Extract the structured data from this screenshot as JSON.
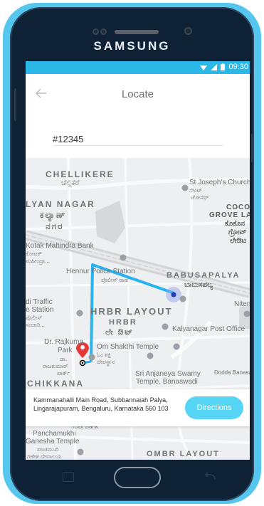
{
  "device": {
    "brand": "SAMSUNG"
  },
  "status_bar": {
    "time": "09:30",
    "icons": [
      "wifi-icon",
      "signal-icon",
      "battery-icon"
    ]
  },
  "app_bar": {
    "title": "Locate",
    "back_icon": "arrow-left-icon"
  },
  "search": {
    "value": "#12345"
  },
  "map": {
    "labels": {
      "chellikere": "CHELLIKERE",
      "chellikere_kn": "ಚೆಲ್ಲಿಕೆರೆ",
      "church": "St Joseph's Church",
      "church_kn1": "ಸೇಂಟ್",
      "church_kn2": "ಜೋಸೆಫ್",
      "kalyan_nagar": "LYAN NAGAR",
      "kalyan_kn1": "ಕಲ್ಯಾಣ್",
      "kalyan_kn2": "ನಗರ",
      "cocon": "COCON",
      "grove": "GROVE LA",
      "grove_kn1": "ಕೊಕೊನ",
      "grove_kn2": "ಗ್ರೋವ್",
      "grove_kn3": "ಲೇಔಟ",
      "kotak": "Kotak Mahindra Bank",
      "kotak_kn1": "ಕೋಟಕ್",
      "kotak_kn2": "ಮಹೀಂದ್ರಾ...",
      "hennur": "Hennur Police Station",
      "hennur_kn": "ಪೊಲೀಸ್ ಠಾಣೆ",
      "babusapalya": "BABUSAPALYA",
      "babusapalya_kn": "ಬಾಬುಸಪಲ್ಯ",
      "traffic1": "di Traffic",
      "traffic2": "e Station",
      "traffic_kn1": "ಪೊಲೀಸ್",
      "traffic_kn2": "ಸಂಚಾರಿ...",
      "hrbr": "HRBR LAYOUT",
      "hrbr2": "HRBR",
      "hrbr_kn": "ಲೇ ಔಟ್",
      "niten": "Niten",
      "kalyan_po": "Kalyanagar Post Office",
      "rajkumar": "Dr. Rajkuma",
      "park": "Park",
      "park_kn1": "ಡಾ.",
      "park_kn2": "ರಾಜಕುಮಾರ್",
      "park_kn3": "ಪಾರ್ಕ್",
      "temple": "Om Shakthi Temple",
      "temple_kn1": "ಓಂ ಶಕ್ತಿ",
      "temple_kn2": "ದೇವಸ್ಥಾನ",
      "anjaneya1": "Sri Anjaneya Swamy",
      "anjaneya2": "Temple, Banaswadi",
      "banaswadi": "Dodda Banaswad",
      "chikkana": "CHIKKANA",
      "ibh": "IDBI Bank",
      "panchamukhi1": "Panchamukhi",
      "panchamukhi2": "Ganesha Temple",
      "panchamukhi_kn1": "ಪಂಚಮುಖಿ",
      "panchamukhi_kn2": "ಗಣೇಶ ದೇವಾಲಯ",
      "ombr": "OMBR LAYOUT"
    }
  },
  "location_card": {
    "address": "Kammanahalli Main Road, Subbannaiah Palya, Lingarajapuram, Bengaluru, Karnataka 560 103",
    "button_label": "Directions"
  },
  "colors": {
    "accent": "#2ab8e8",
    "route": "#29b4f0",
    "button": "#55d4f4",
    "pin": "#e53935"
  }
}
